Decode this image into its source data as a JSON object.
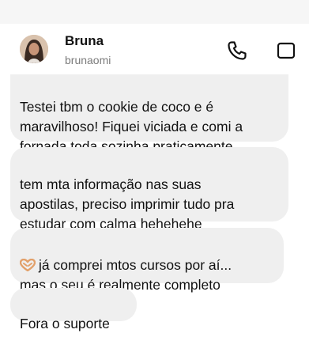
{
  "contact": {
    "name": "Bruna",
    "username": "brunaomi"
  },
  "messages": [
    {
      "text": "Testei tbm o cookie de coco e é\nmaravilhoso! Fiquei viciada e comi a\nfornada toda sozinha praticamente"
    },
    {
      "text": "tem mta informação nas suas\napostilas, preciso imprimir tudo pra\nestudar com calma hehehehe"
    },
    {
      "text": "já comprei mtos cursos por aí...\nmas o seu é realmente completo",
      "emoji": "heart-hands-emoji"
    },
    {
      "text": "Fora o suporte"
    }
  ],
  "icons": {
    "call": "phone-icon",
    "video": "video-call-icon"
  },
  "colors": {
    "bubble": "#efefef",
    "username": "#7b7b7b",
    "emoji": "#e2a06a"
  }
}
